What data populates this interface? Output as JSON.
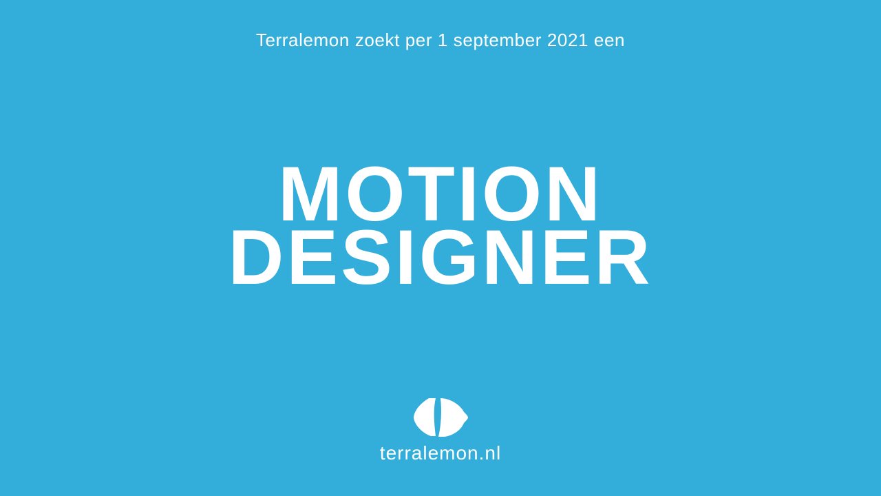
{
  "intro_text": "Terralemon zoekt per 1 september 2021 een",
  "headline": {
    "line1": "MOTION",
    "line2": "DESIGNER"
  },
  "footer": {
    "logo_icon": "terralemon-logo-icon",
    "domain": "terralemon.nl"
  },
  "colors": {
    "background": "#33AEDB",
    "foreground": "#FFFFFF"
  }
}
